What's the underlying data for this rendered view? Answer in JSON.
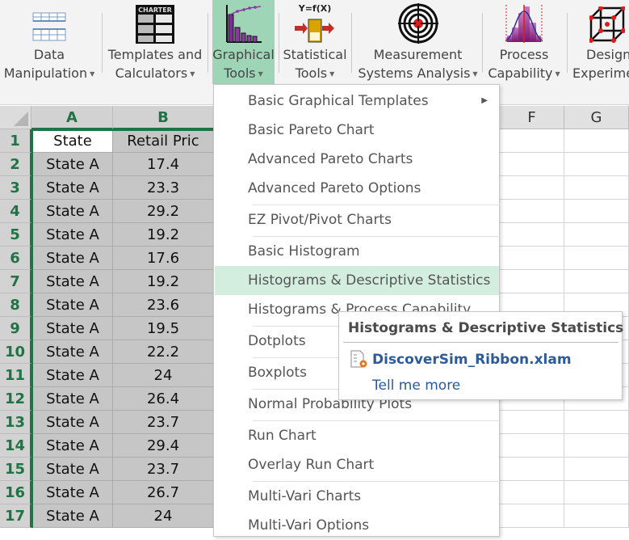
{
  "ribbon": {
    "buttons": [
      {
        "line1": "Data",
        "line2": "Manipulation",
        "icon": "data-manipulation-icon"
      },
      {
        "line1": "Templates and",
        "line2": "Calculators",
        "icon": "charter-template-icon",
        "icon_text": "CHARTER"
      },
      {
        "line1": "Graphical",
        "line2": "Tools",
        "icon": "pareto-chart-icon",
        "active": true
      },
      {
        "line1": "Statistical",
        "line2": "Tools",
        "icon": "yfx-icon",
        "icon_text": "Y=f(X)"
      },
      {
        "line1": "Measurement",
        "line2": "Systems Analysis",
        "icon": "target-icon"
      },
      {
        "line1": "Process",
        "line2": "Capability",
        "icon": "capability-histogram-icon"
      },
      {
        "line1": "Design",
        "line2": "Experime",
        "icon": "cube-icon"
      }
    ],
    "caret_glyph": "▼",
    "active_color": "#9fd5b7"
  },
  "sheet": {
    "columns": [
      "A",
      "B",
      "F",
      "G"
    ],
    "rows": [
      "1",
      "2",
      "3",
      "4",
      "5",
      "6",
      "7",
      "8",
      "9",
      "10",
      "11",
      "12",
      "13",
      "14",
      "15",
      "16",
      "17"
    ],
    "header_row": [
      "State",
      "Retail Pric"
    ],
    "data": [
      [
        "State A",
        "17.4"
      ],
      [
        "State A",
        "23.3"
      ],
      [
        "State A",
        "29.2"
      ],
      [
        "State A",
        "19.2"
      ],
      [
        "State A",
        "17.6"
      ],
      [
        "State A",
        "19.2"
      ],
      [
        "State A",
        "23.6"
      ],
      [
        "State A",
        "19.5"
      ],
      [
        "State A",
        "22.2"
      ],
      [
        "State A",
        "24"
      ],
      [
        "State A",
        "26.4"
      ],
      [
        "State A",
        "23.7"
      ],
      [
        "State A",
        "29.4"
      ],
      [
        "State A",
        "23.7"
      ],
      [
        "State A",
        "26.7"
      ],
      [
        "State A",
        "24"
      ]
    ],
    "accent_color": "#217346"
  },
  "menu": {
    "items": [
      {
        "label": "Basic Graphical Templates",
        "submenu": true
      },
      {
        "label": "Basic Pareto Chart"
      },
      {
        "label": "Advanced Pareto Charts"
      },
      {
        "label": "Advanced Pareto Options"
      },
      {
        "label": "EZ Pivot/Pivot Charts"
      },
      {
        "label": "Basic Histogram"
      },
      {
        "label": "Histograms & Descriptive Statistics",
        "highlighted": true
      },
      {
        "label": "Histograms & Process Capability"
      },
      {
        "label": "Dotplots"
      },
      {
        "label": "Boxplots"
      },
      {
        "label": "Normal Probability Plots"
      },
      {
        "label": "Run Chart"
      },
      {
        "label": "Overlay Run Chart"
      },
      {
        "label": "Multi-Vari Charts"
      },
      {
        "label": "Multi-Vari Options"
      }
    ],
    "submenu_glyph": "▶",
    "highlight_color": "#d3eedf"
  },
  "tooltip": {
    "title": "Histograms & Descriptive Statistics",
    "file": "DiscoverSim_Ribbon.xlam",
    "link": "Tell me more",
    "link_color": "#2b5b9a"
  }
}
